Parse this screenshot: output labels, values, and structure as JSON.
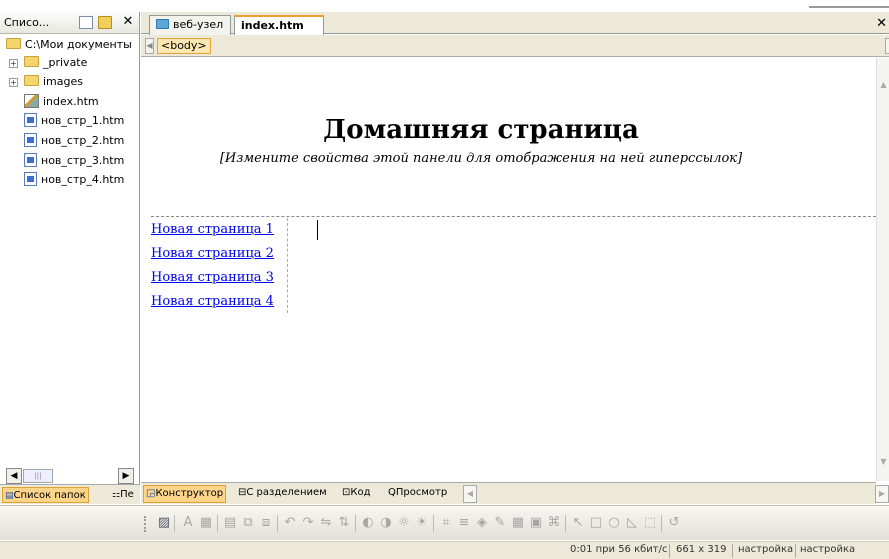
{
  "left_panel": {
    "title": "Списо...",
    "tree": [
      {
        "label": "C:\\Мои документы",
        "icon": "folder-icon"
      },
      {
        "label": "_private",
        "icon": "folder-icon",
        "expandable": true
      },
      {
        "label": "images",
        "icon": "folder-icon",
        "expandable": true
      },
      {
        "label": "index.htm",
        "icon": "edit-page-icon"
      },
      {
        "label": "нов_стр_1.htm",
        "icon": "page-icon"
      },
      {
        "label": "нов_стр_2.htm",
        "icon": "page-icon"
      },
      {
        "label": "нов_стр_3.htm",
        "icon": "page-icon"
      },
      {
        "label": "нов_стр_4.htm",
        "icon": "page-icon"
      }
    ],
    "bottom_tabs": {
      "folder_list": "Список папок",
      "navigation": "Пе"
    }
  },
  "document_tabs": [
    {
      "label": "веб-узел",
      "active": false
    },
    {
      "label": "index.htm",
      "active": true
    }
  ],
  "tag_selector": "<body>",
  "page": {
    "heading": "Домашняя страница",
    "subtitle": "[Измените свойства этой панели для отображения на ней гиперссылок]",
    "links": [
      "Новая страница 1",
      "Новая страница 2",
      "Новая страница 3",
      "Новая страница 4"
    ]
  },
  "view_tabs": {
    "design": "Конструктор",
    "split": "С разделением",
    "code": "Код",
    "preview": "Просмотр"
  },
  "status": {
    "download_time": "0:01 при 56 кбит/с",
    "dimensions": "661 x 319",
    "setting_1": "настройка",
    "setting_2": "настройка"
  },
  "colors": {
    "active_tab": "#fcd48a",
    "link": "#0000ee",
    "chrome": "#ece9d8"
  }
}
